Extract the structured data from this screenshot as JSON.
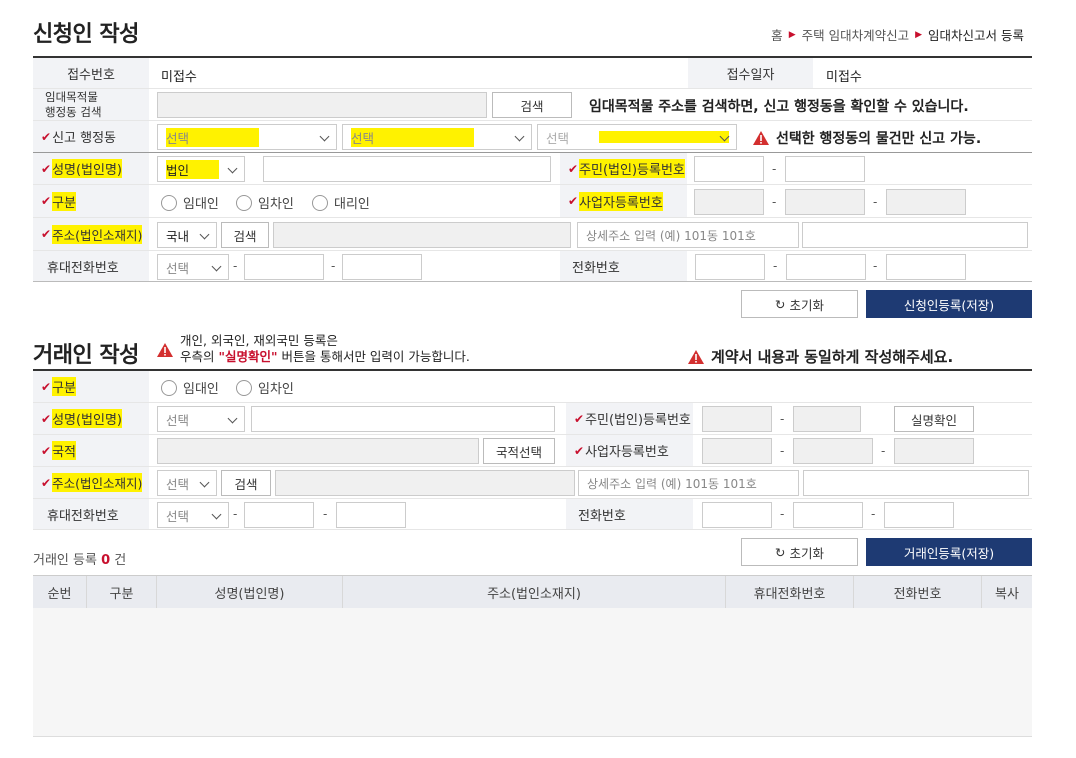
{
  "header": {
    "title": "신청인 작성",
    "breadcrumb": [
      "홈",
      "주택 임대차계약신고",
      "임대차신고서 등록"
    ]
  },
  "applicant": {
    "receipt_no_label": "접수번호",
    "receipt_no_value": "미접수",
    "receipt_date_label": "접수일자",
    "receipt_date_value": "미접수",
    "property_search_label": "임대목적물\n행정동 검색",
    "search_button": "검색",
    "property_search_hint": "임대목적물 주소를 검색하면, 신고 행정동을 확인할 수 있습니다.",
    "admin_dong_label": "신고 행정동",
    "select_placeholder": "선택",
    "admin_dong_warning": "선택한 행정동의 물건만 신고 가능.",
    "name_label": "성명(법인명)",
    "name_type_value": "법인",
    "resident_no_label": "주민(법인)등록번호",
    "type_label": "구분",
    "type_options": [
      "임대인",
      "임차인",
      "대리인"
    ],
    "biz_no_label": "사업자등록번호",
    "address_label": "주소(법인소재지)",
    "address_scope_value": "국내",
    "address_search_button": "검색",
    "address_detail_placeholder": "상세주소 입력 (예) 101동 101호",
    "mobile_label": "휴대전화번호",
    "phone_label": "전화번호",
    "dash": "-",
    "reset_button": "초기화",
    "submit_button": "신청인등록(저장)"
  },
  "trader": {
    "title": "거래인 작성",
    "note_line1": "개인, 외국인, 재외국민 등록은",
    "note_line2_prefix": "우측의 ",
    "note_line2_highlight": "\"실명확인\"",
    "note_line2_suffix": " 버튼을 통해서만 입력이 가능합니다.",
    "contract_warning": "계약서 내용과 동일하게 작성해주세요.",
    "type_label": "구분",
    "type_options": [
      "임대인",
      "임차인"
    ],
    "name_label": "성명(법인명)",
    "select_placeholder": "선택",
    "resident_no_label": "주민(법인)등록번호",
    "verify_button": "실명확인",
    "nationality_label": "국적",
    "nationality_button": "국적선택",
    "biz_no_label": "사업자등록번호",
    "address_label": "주소(법인소재지)",
    "address_search_button": "검색",
    "address_detail_placeholder": "상세주소 입력 (예) 101동 101호",
    "mobile_label": "휴대전화번호",
    "phone_label": "전화번호",
    "count_prefix": "거래인 등록 ",
    "count_value": "0",
    "count_suffix": " 건",
    "reset_button": "초기화",
    "submit_button": "거래인등록(저장)"
  },
  "table": {
    "columns": [
      "순번",
      "구분",
      "성명(법인명)",
      "주소(법인소재지)",
      "휴대전화번호",
      "전화번호",
      "복사"
    ]
  },
  "colors": {
    "primary_button": "#1e3a73",
    "required_mark": "#c8102e",
    "highlight": "#fff200"
  }
}
